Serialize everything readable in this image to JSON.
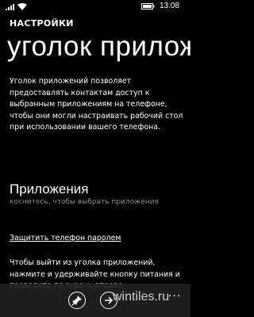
{
  "status_bar": {
    "time": "13:08",
    "icons": [
      "signal-icon",
      "wifi-icon",
      "battery-icon"
    ]
  },
  "header": {
    "section": "НАСТРОЙКИ",
    "title": "уголок приложений"
  },
  "description": "Уголок приложений позволяет предоставлять контактам доступ к выбранным приложениям на телефоне, чтобы они могли настраивать рабочий стол при использовании вашего телефона.",
  "apps": {
    "header": "Приложения",
    "hint": "коснитесь, чтобы выбрать приложения"
  },
  "protect_link": "Защитить телефон паролем",
  "hold_text": "Чтобы выйти из уголка приложений, нажмите и удерживайте кнопку питания и проведите по экрану вправо.",
  "app_bar": {
    "buttons": [
      "pin-icon",
      "next-icon"
    ],
    "more": "..."
  },
  "watermark": "wintiles.ru",
  "colors": {
    "background": "#000000",
    "text": "#ffffff",
    "hint": "#8c8c8c",
    "app_bar": "#1f1f1f"
  }
}
